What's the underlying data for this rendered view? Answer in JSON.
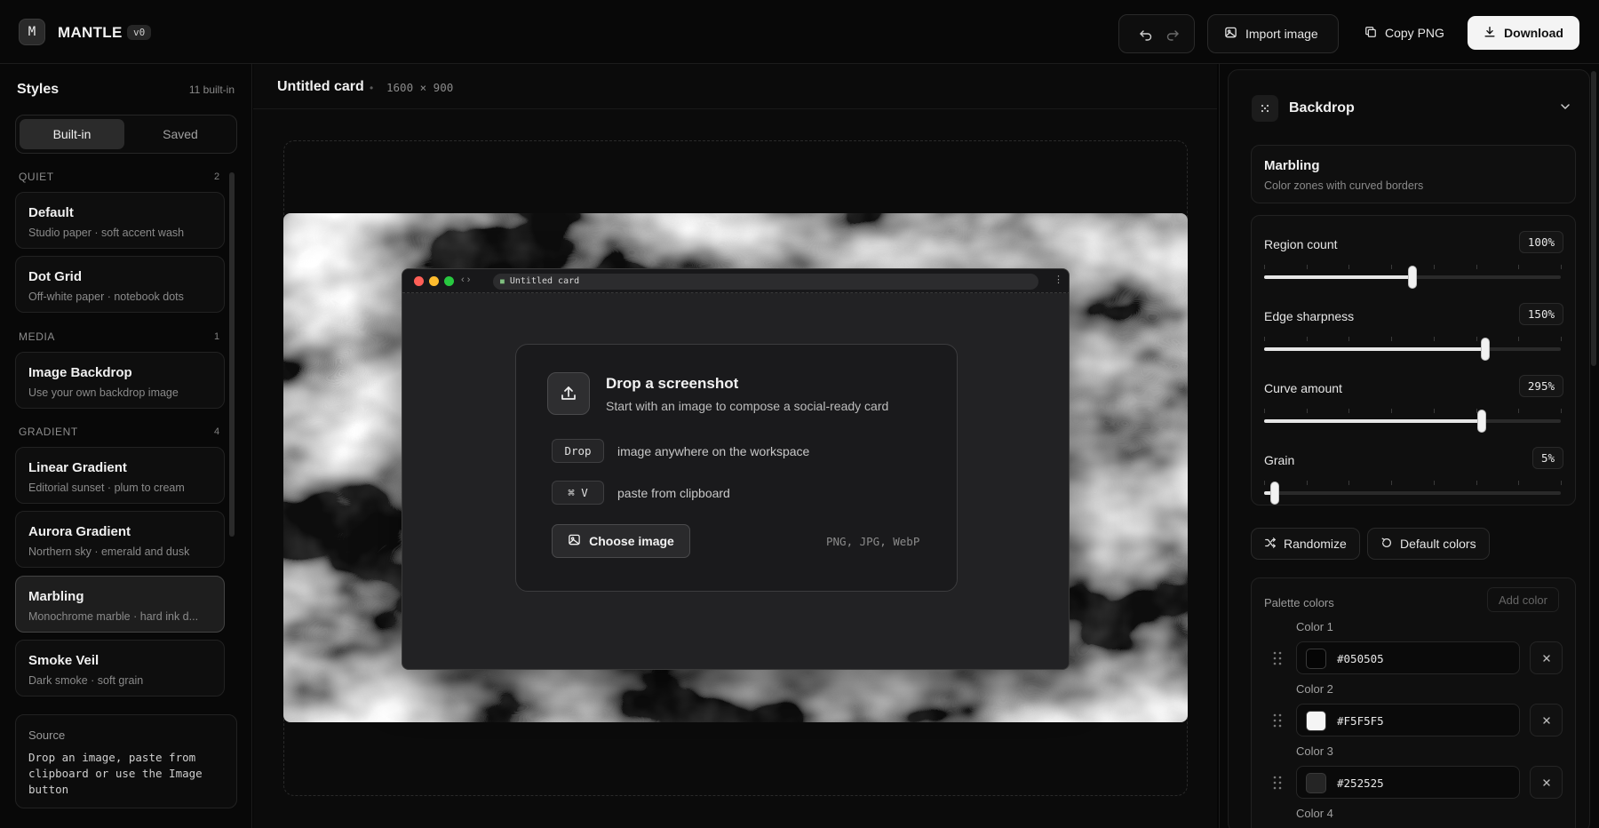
{
  "app": {
    "logo_letter": "M",
    "name": "MANTLE",
    "version": "v0"
  },
  "toolbar": {
    "import_label": "Import image",
    "copy_label": "Copy PNG",
    "download_label": "Download"
  },
  "styles_panel": {
    "title": "Styles",
    "count": "11 built-in",
    "tabs": {
      "active": "Built-in",
      "inactive": "Saved"
    },
    "groups": [
      {
        "label": "QUIET",
        "count": "2"
      },
      {
        "label": "MEDIA",
        "count": "1"
      },
      {
        "label": "GRADIENT",
        "count": "4"
      }
    ],
    "items": [
      {
        "title": "Default",
        "desc": "Studio paper · soft accent wash"
      },
      {
        "title": "Dot Grid",
        "desc": "Off-white paper · notebook dots"
      },
      {
        "title": "Image Backdrop",
        "desc": "Use your own backdrop image"
      },
      {
        "title": "Linear Gradient",
        "desc": "Editorial sunset · plum to cream"
      },
      {
        "title": "Aurora Gradient",
        "desc": "Northern sky · emerald and dusk"
      },
      {
        "title": "Marbling",
        "desc": "Monochrome marble · hard ink d..."
      },
      {
        "title": "Smoke Veil",
        "desc": "Dark smoke · soft grain"
      }
    ],
    "selected_index": 5,
    "source": {
      "label": "Source",
      "body": "Drop an image, paste from clipboard or use the Image button"
    }
  },
  "canvas": {
    "title": "Untitled card",
    "separator": "•",
    "dims": "1600 × 900",
    "browser_url": "Untitled card",
    "browser_menu": "⋮",
    "drop": {
      "title": "Drop a screenshot",
      "subtitle": "Start with an image to compose a social-ready card",
      "rows": [
        {
          "key": "Drop",
          "text": "image anywhere on the workspace"
        },
        {
          "key": "⌘ V",
          "text": "paste from clipboard"
        }
      ],
      "choose_label": "Choose image",
      "formats": "PNG, JPG, WebP"
    }
  },
  "backdrop_panel": {
    "title": "Backdrop",
    "preset": {
      "title": "Marbling",
      "desc": "Color zones with curved borders"
    },
    "sliders": [
      {
        "label": "Region count",
        "value": "100%",
        "position": 0.5
      },
      {
        "label": "Edge sharpness",
        "value": "150%",
        "position": 0.745
      },
      {
        "label": "Curve amount",
        "value": "295%",
        "position": 0.733
      },
      {
        "label": "Grain",
        "value": "5%",
        "position": 0.035
      }
    ],
    "randomize_label": "Randomize",
    "default_colors_label": "Default colors",
    "palette": {
      "title": "Palette colors",
      "add_label": "Add color",
      "colors": [
        {
          "label": "Color 1",
          "hex": "#050505"
        },
        {
          "label": "Color 2",
          "hex": "#F5F5F5"
        },
        {
          "label": "Color 3",
          "hex": "#252525"
        },
        {
          "label": "Color 4",
          "hex": ""
        }
      ]
    }
  }
}
